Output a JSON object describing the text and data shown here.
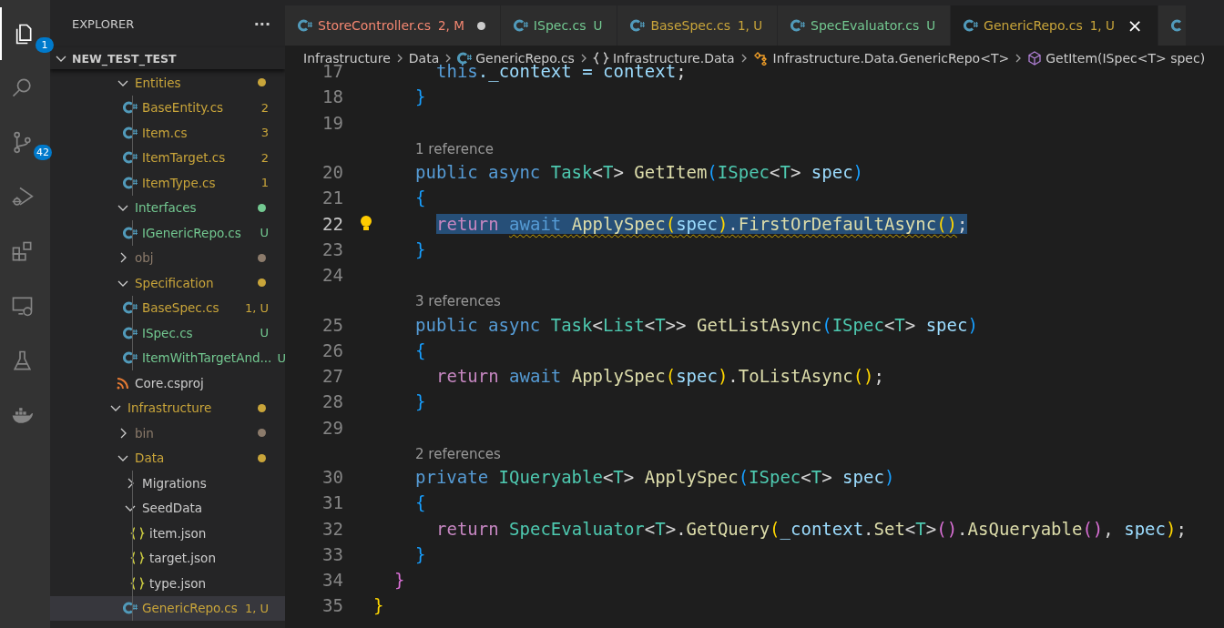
{
  "activity_bar": [
    {
      "kind": "files",
      "selected": true,
      "badge": "1"
    },
    {
      "kind": "search",
      "selected": false
    },
    {
      "kind": "source-control",
      "selected": false,
      "badge": "42"
    },
    {
      "kind": "debug",
      "selected": false
    },
    {
      "kind": "extensions",
      "selected": false
    },
    {
      "kind": "remote",
      "selected": false
    },
    {
      "kind": "testing",
      "selected": false
    },
    {
      "kind": "docker",
      "selected": false
    }
  ],
  "sidebar": {
    "title": "EXPLORER",
    "more": "···",
    "root": {
      "label": "NEW_TEST_TEST",
      "expanded": true,
      "children": [
        {
          "children": [
            {
              "label": "Entities",
              "kind": "folder",
              "expanded": true,
              "color": "#c9a53a",
              "selected": false,
              "children": [
                {
                  "label": "BaseEntity.cs",
                  "kind": "cs",
                  "color": "#c9a53a",
                  "decoration": "2",
                  "selected": false
                },
                {
                  "label": "Item.cs",
                  "kind": "cs",
                  "color": "#c9a53a",
                  "decoration": "3",
                  "selected": false
                },
                {
                  "label": "ItemTarget.cs",
                  "kind": "cs",
                  "color": "#c9a53a",
                  "decoration": "2",
                  "selected": false
                },
                {
                  "label": "ItemType.cs",
                  "kind": "cs",
                  "color": "#c9a53a",
                  "decoration": "1",
                  "selected": false
                }
              ]
            },
            {
              "label": "Interfaces",
              "kind": "folder",
              "expanded": true,
              "color": "#73c991",
              "selected": false,
              "children": [
                {
                  "label": "IGenericRepo.cs",
                  "kind": "cs",
                  "color": "#73c991",
                  "decoration": "U",
                  "selected": false
                }
              ]
            },
            {
              "label": "obj",
              "kind": "folder",
              "expanded": false,
              "color": "#8c7b6b",
              "selected": false
            },
            {
              "label": "Specification",
              "kind": "folder",
              "expanded": true,
              "color": "#c9a53a",
              "selected": false,
              "children": [
                {
                  "label": "BaseSpec.cs",
                  "kind": "cs",
                  "color": "#c9a53a",
                  "decoration": "1, U",
                  "selected": false
                },
                {
                  "label": "ISpec.cs",
                  "kind": "cs",
                  "color": "#73c991",
                  "decoration": "U",
                  "selected": false
                },
                {
                  "label": "ItemWithTargetAnd...",
                  "kind": "cs",
                  "color": "#73c991",
                  "decoration": "U",
                  "selected": false
                }
              ]
            },
            {
              "label": "Core.csproj",
              "kind": "csproj",
              "selected": false
            }
          ]
        },
        {
          "label": "Infrastructure",
          "kind": "folder",
          "expanded": true,
          "color": "#c9a53a",
          "selected": false,
          "children": [
            {
              "label": "bin",
              "kind": "folder",
              "expanded": false,
              "color": "#8c7b6b",
              "selected": false
            },
            {
              "label": "Data",
              "kind": "folder",
              "expanded": true,
              "color": "#c9a53a",
              "selected": false,
              "children": [
                {
                  "label": "Migrations",
                  "kind": "folder",
                  "expanded": false,
                  "selected": false
                },
                {
                  "label": "SeedData",
                  "kind": "folder",
                  "expanded": true,
                  "selected": false,
                  "children": [
                    {
                      "label": "item.json",
                      "kind": "json",
                      "selected": false
                    },
                    {
                      "label": "target.json",
                      "kind": "json",
                      "selected": false
                    },
                    {
                      "label": "type.json",
                      "kind": "json",
                      "selected": false
                    }
                  ]
                },
                {
                  "label": "GenericRepo.cs",
                  "kind": "cs",
                  "color": "#c9a53a",
                  "decoration": "1, U",
                  "selected": true
                }
              ]
            }
          ]
        }
      ]
    }
  },
  "tabs": [
    {
      "label": "StoreController.cs",
      "decoration": "2, M",
      "color": "#f48771",
      "dirty": true,
      "selected": false
    },
    {
      "label": "ISpec.cs",
      "decoration": "U",
      "color": "#73c991",
      "dirty": false,
      "selected": false
    },
    {
      "label": "BaseSpec.cs",
      "decoration": "1, U",
      "color": "#c9a53a",
      "dirty": false,
      "selected": false
    },
    {
      "label": "SpecEvaluator.cs",
      "decoration": "U",
      "color": "#73c991",
      "dirty": false,
      "selected": false
    },
    {
      "label": "GenericRepo.cs",
      "decoration": "1, U",
      "color": "#c9a53a",
      "dirty": false,
      "selected": true,
      "close": "×"
    }
  ],
  "breadcrumbs": [
    {
      "label": "Infrastructure",
      "kind": "folder"
    },
    {
      "label": "Data",
      "kind": "folder"
    },
    {
      "label": "GenericRepo.cs",
      "kind": "cs"
    },
    {
      "label": "Infrastructure.Data",
      "kind": "namespace"
    },
    {
      "label": "Infrastructure.Data.GenericRepo<T>",
      "kind": "class"
    },
    {
      "label": "GetItem(ISpec<T> spec)",
      "kind": "method"
    }
  ],
  "editor": {
    "lines": [
      {
        "children": [
          {
            "children": [
              {
                "children": [
                  {
                    "kind": "code",
                    "number": "17",
                    "tokens": [
                      {
                        "t": "this",
                        "kind": "kw"
                      },
                      {
                        "t": "._context = ",
                        "kind": "var"
                      },
                      {
                        "t": "context",
                        "kind": "var"
                      },
                      {
                        "t": ";",
                        "kind": "p"
                      }
                    ]
                  }
                ]
              },
              {
                "kind": "code",
                "number": "18",
                "tokens": [
                  {
                    "t": "}",
                    "kind": "b3"
                  }
                ]
              },
              {
                "kind": "code",
                "number": "19"
              },
              {
                "kind": "lens",
                "text": "1 reference"
              },
              {
                "kind": "code",
                "number": "20",
                "tokens": [
                  {
                    "t": "public ",
                    "kind": "kw"
                  },
                  {
                    "t": "async ",
                    "kind": "kw"
                  },
                  {
                    "t": "Task",
                    "kind": "type"
                  },
                  {
                    "t": "<",
                    "kind": "p"
                  },
                  {
                    "t": "T",
                    "kind": "type"
                  },
                  {
                    "t": "> ",
                    "kind": "p"
                  },
                  {
                    "t": "GetItem",
                    "kind": "fn"
                  },
                  {
                    "t": "(",
                    "kind": "b3"
                  },
                  {
                    "t": "ISpec",
                    "kind": "type"
                  },
                  {
                    "t": "<",
                    "kind": "p"
                  },
                  {
                    "t": "T",
                    "kind": "type"
                  },
                  {
                    "t": "> ",
                    "kind": "p"
                  },
                  {
                    "t": "spec",
                    "kind": "var"
                  },
                  {
                    "t": ")",
                    "kind": "b3"
                  }
                ]
              },
              {
                "kind": "code",
                "number": "21",
                "tokens": [
                  {
                    "t": "{",
                    "kind": "b3"
                  }
                ]
              },
              {
                "children": [
                  {
                    "kind": "code",
                    "number": "22",
                    "current": true,
                    "selected": true,
                    "lightbulb": true,
                    "tokens": [
                      {
                        "t": "return ",
                        "kind": "ctl"
                      },
                      {
                        "t": "await ",
                        "kind": "kw",
                        "warning": true
                      },
                      {
                        "t": "ApplySpec",
                        "kind": "fn",
                        "warning": true
                      },
                      {
                        "t": "(",
                        "kind": "b1",
                        "warning": true
                      },
                      {
                        "t": "spec",
                        "kind": "var",
                        "warning": true
                      },
                      {
                        "t": ")",
                        "kind": "b1",
                        "warning": true
                      },
                      {
                        "t": ".",
                        "kind": "p",
                        "warning": true
                      },
                      {
                        "t": "FirstOrDefaultAsync",
                        "kind": "fn",
                        "warning": true
                      },
                      {
                        "t": "()",
                        "kind": "b1",
                        "warning": true
                      },
                      {
                        "t": ";",
                        "kind": "p"
                      }
                    ]
                  }
                ]
              },
              {
                "kind": "code",
                "number": "23",
                "tokens": [
                  {
                    "t": "}",
                    "kind": "b3"
                  }
                ]
              },
              {
                "kind": "code",
                "number": "24"
              },
              {
                "kind": "lens",
                "text": "3 references"
              },
              {
                "kind": "code",
                "number": "25",
                "tokens": [
                  {
                    "t": "public ",
                    "kind": "kw"
                  },
                  {
                    "t": "async ",
                    "kind": "kw"
                  },
                  {
                    "t": "Task",
                    "kind": "type"
                  },
                  {
                    "t": "<",
                    "kind": "p"
                  },
                  {
                    "t": "List",
                    "kind": "type"
                  },
                  {
                    "t": "<",
                    "kind": "p"
                  },
                  {
                    "t": "T",
                    "kind": "type"
                  },
                  {
                    "t": ">> ",
                    "kind": "p"
                  },
                  {
                    "t": "GetListAsync",
                    "kind": "fn"
                  },
                  {
                    "t": "(",
                    "kind": "b3"
                  },
                  {
                    "t": "ISpec",
                    "kind": "type"
                  },
                  {
                    "t": "<",
                    "kind": "p"
                  },
                  {
                    "t": "T",
                    "kind": "type"
                  },
                  {
                    "t": "> ",
                    "kind": "p"
                  },
                  {
                    "t": "spec",
                    "kind": "var"
                  },
                  {
                    "t": ")",
                    "kind": "b3"
                  }
                ]
              },
              {
                "kind": "code",
                "number": "26",
                "tokens": [
                  {
                    "t": "{",
                    "kind": "b3"
                  }
                ]
              },
              {
                "children": [
                  {
                    "kind": "code",
                    "number": "27",
                    "tokens": [
                      {
                        "t": "return ",
                        "kind": "ctl"
                      },
                      {
                        "t": "await ",
                        "kind": "kw"
                      },
                      {
                        "t": "ApplySpec",
                        "kind": "fn"
                      },
                      {
                        "t": "(",
                        "kind": "b1"
                      },
                      {
                        "t": "spec",
                        "kind": "var"
                      },
                      {
                        "t": ")",
                        "kind": "b1"
                      },
                      {
                        "t": ".",
                        "kind": "p"
                      },
                      {
                        "t": "ToListAsync",
                        "kind": "fn"
                      },
                      {
                        "t": "()",
                        "kind": "b1"
                      },
                      {
                        "t": ";",
                        "kind": "p"
                      }
                    ]
                  }
                ]
              },
              {
                "kind": "code",
                "number": "28",
                "tokens": [
                  {
                    "t": "}",
                    "kind": "b3"
                  }
                ]
              },
              {
                "kind": "code",
                "number": "29"
              },
              {
                "kind": "lens",
                "text": "2 references"
              },
              {
                "kind": "code",
                "number": "30",
                "tokens": [
                  {
                    "t": "private ",
                    "kind": "kw"
                  },
                  {
                    "t": "IQueryable",
                    "kind": "type"
                  },
                  {
                    "t": "<",
                    "kind": "p"
                  },
                  {
                    "t": "T",
                    "kind": "type"
                  },
                  {
                    "t": "> ",
                    "kind": "p"
                  },
                  {
                    "t": "ApplySpec",
                    "kind": "fn"
                  },
                  {
                    "t": "(",
                    "kind": "b3"
                  },
                  {
                    "t": "ISpec",
                    "kind": "type"
                  },
                  {
                    "t": "<",
                    "kind": "p"
                  },
                  {
                    "t": "T",
                    "kind": "type"
                  },
                  {
                    "t": "> ",
                    "kind": "p"
                  },
                  {
                    "t": "spec",
                    "kind": "var"
                  },
                  {
                    "t": ")",
                    "kind": "b3"
                  }
                ]
              },
              {
                "kind": "code",
                "number": "31",
                "tokens": [
                  {
                    "t": "{",
                    "kind": "b3"
                  }
                ]
              },
              {
                "children": [
                  {
                    "kind": "code",
                    "number": "32",
                    "tokens": [
                      {
                        "t": "return ",
                        "kind": "ctl"
                      },
                      {
                        "t": "SpecEvaluator",
                        "kind": "type"
                      },
                      {
                        "t": "<",
                        "kind": "p"
                      },
                      {
                        "t": "T",
                        "kind": "type"
                      },
                      {
                        "t": ">.",
                        "kind": "p"
                      },
                      {
                        "t": "GetQuery",
                        "kind": "fn"
                      },
                      {
                        "t": "(",
                        "kind": "b1"
                      },
                      {
                        "t": "_context",
                        "kind": "var"
                      },
                      {
                        "t": ".",
                        "kind": "p"
                      },
                      {
                        "t": "Set",
                        "kind": "fn"
                      },
                      {
                        "t": "<",
                        "kind": "p"
                      },
                      {
                        "t": "T",
                        "kind": "type"
                      },
                      {
                        "t": ">",
                        "kind": "p"
                      },
                      {
                        "t": "()",
                        "kind": "b2"
                      },
                      {
                        "t": ".",
                        "kind": "p"
                      },
                      {
                        "t": "AsQueryable",
                        "kind": "fn"
                      },
                      {
                        "t": "()",
                        "kind": "b2"
                      },
                      {
                        "t": ", ",
                        "kind": "p"
                      },
                      {
                        "t": "spec",
                        "kind": "var"
                      },
                      {
                        "t": ")",
                        "kind": "b1"
                      },
                      {
                        "t": ";",
                        "kind": "p"
                      }
                    ]
                  }
                ]
              },
              {
                "kind": "code",
                "number": "33",
                "tokens": [
                  {
                    "t": "}",
                    "kind": "b3"
                  }
                ]
              }
            ]
          },
          {
            "kind": "code",
            "number": "34",
            "tokens": [
              {
                "t": "}",
                "kind": "b2"
              }
            ]
          }
        ]
      },
      {
        "kind": "code",
        "number": "35",
        "tokens": [
          {
            "t": "}",
            "kind": "b1"
          }
        ]
      }
    ]
  }
}
